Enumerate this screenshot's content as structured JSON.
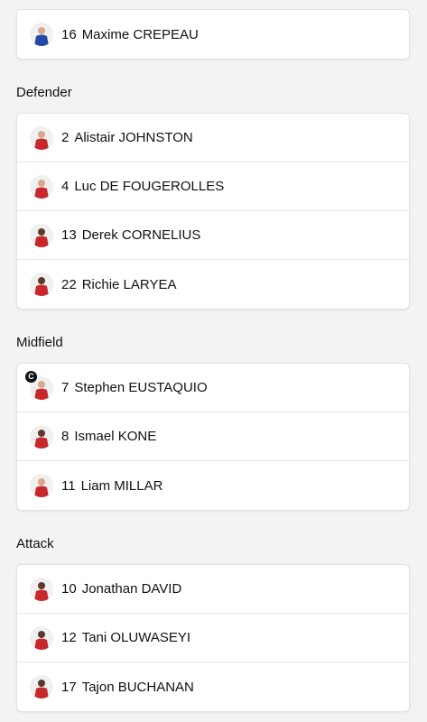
{
  "goalkeeper": {
    "players": [
      {
        "number": "16",
        "name": "Maxime CREPEAU",
        "kit": "blue"
      }
    ]
  },
  "defender": {
    "title": "Defender",
    "players": [
      {
        "number": "2",
        "name": "Alistair JOHNSTON",
        "kit": "red"
      },
      {
        "number": "4",
        "name": "Luc DE FOUGEROLLES",
        "kit": "red"
      },
      {
        "number": "13",
        "name": "Derek CORNELIUS",
        "kit": "red"
      },
      {
        "number": "22",
        "name": "Richie LARYEA",
        "kit": "red"
      }
    ]
  },
  "midfield": {
    "title": "Midfield",
    "captain_badge": "C",
    "players": [
      {
        "number": "7",
        "name": "Stephen EUSTAQUIO",
        "kit": "red"
      },
      {
        "number": "8",
        "name": "Ismael KONE",
        "kit": "red"
      },
      {
        "number": "11",
        "name": "Liam MILLAR",
        "kit": "red"
      }
    ]
  },
  "attack": {
    "title": "Attack",
    "players": [
      {
        "number": "10",
        "name": "Jonathan DAVID",
        "kit": "red"
      },
      {
        "number": "12",
        "name": "Tani OLUWASEYI",
        "kit": "red"
      },
      {
        "number": "17",
        "name": "Tajon BUCHANAN",
        "kit": "red"
      }
    ]
  },
  "colors": {
    "kit_red": "#c8282c",
    "kit_blue": "#2447a8",
    "skin_dark": "#5a3a2a",
    "skin_light": "#d9a88a"
  }
}
